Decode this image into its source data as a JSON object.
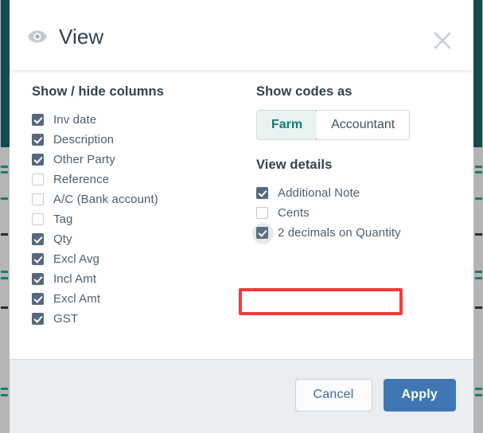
{
  "dialog": {
    "title": "View",
    "icon": "eye-icon",
    "close_icon": "close-icon"
  },
  "columns_section": {
    "heading": "Show / hide columns",
    "items": [
      {
        "label": "Inv date",
        "checked": true
      },
      {
        "label": "Description",
        "checked": true
      },
      {
        "label": "Other Party",
        "checked": true
      },
      {
        "label": "Reference",
        "checked": false
      },
      {
        "label": "A/C (Bank account)",
        "checked": false
      },
      {
        "label": "Tag",
        "checked": false
      },
      {
        "label": "Qty",
        "checked": true
      },
      {
        "label": "Excl Avg",
        "checked": true
      },
      {
        "label": "Incl Amt",
        "checked": true
      },
      {
        "label": "Excl Amt",
        "checked": true
      },
      {
        "label": "GST",
        "checked": true
      }
    ]
  },
  "codes_section": {
    "heading": "Show codes as",
    "options": [
      {
        "label": "Farm",
        "selected": true
      },
      {
        "label": "Accountant",
        "selected": false
      }
    ],
    "selected_value": "Farm"
  },
  "details_section": {
    "heading": "View details",
    "items": [
      {
        "label": "Additional Note",
        "checked": true,
        "focused": false
      },
      {
        "label": "Cents",
        "checked": false,
        "focused": false
      },
      {
        "label": "2 decimals on Quantity",
        "checked": true,
        "focused": true
      }
    ]
  },
  "footer": {
    "cancel_label": "Cancel",
    "apply_label": "Apply"
  },
  "colors": {
    "accent_teal": "#139186",
    "primary_blue": "#3f76b3",
    "checkbox_fill": "#55697c",
    "annotation_red": "#f93a3a",
    "footer_bg": "#eaeef1",
    "edge_teal": "#134b4c"
  }
}
